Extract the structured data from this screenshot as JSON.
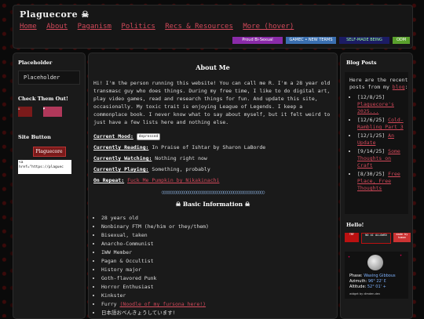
{
  "site": {
    "title": "Plaguecore"
  },
  "nav": [
    "Home",
    "About",
    "Paganism",
    "Politics",
    "Recs & Resources",
    "More (hover)"
  ],
  "header_buttons": [
    {
      "label": "Proud Bi-Sexual",
      "color": "#9c27b0"
    },
    {
      "label": "GAMEC • NEW TERMS",
      "color": "#3a6fb0"
    },
    {
      "label": "SELF-MADE BEING",
      "color": "#1c1c64"
    },
    {
      "label": "ODM",
      "color": "#5aa02c"
    }
  ],
  "left": {
    "placeholder_title": "Placeholder",
    "placeholder_text": "Placeholder",
    "check_title": "Check Them Out!",
    "site_button_title": "Site Button",
    "site_button_label": "Plaguecore",
    "code_snippet": "<a\nhref=\"https://plaguec"
  },
  "main": {
    "title": "About Me",
    "intro": "Hi! I'm the person running this website! You can call me R. I'm a 28 year old transmasc guy who does things. During my free time, I like to do digital art, play video games, read and research things for fun. And update this site, occasionally. My toxic trait is enjoying League of Legends. I keep a commonplace book. I never know what to say about myself, but it felt weird to just have a few lists here and nothing else.",
    "mood_label": "Current Mood:",
    "mood_value": "depressed",
    "reading_label": "Currently Reading:",
    "reading_value": "In Praise of Ishtar by Sharon LaBorde",
    "watching_label": "Currently Watching:",
    "watching_value": "Nothing right now",
    "playing_label": "Currently Playing:",
    "playing_value": "Something, probably",
    "repeat_label": "On Repeat:",
    "repeat_value": "Fuck Me Pumpkin by Nikakinachi",
    "basic_title": "Basic Information",
    "basic_info": [
      "28 years old",
      "Nonbinary FTM (he/him or they/them)",
      "Bisexual, taken",
      "Anarcho-Communist",
      "IWW Member",
      "Pagan & Occultist",
      "History major",
      "Goth-flavored Punk",
      "Horror Enthusiast",
      "Kinkster",
      "Furry",
      "日本語おべんきょうしています!"
    ],
    "furry_link": "(Noodle of my fursona here!)"
  },
  "right": {
    "blog_title": "Blog Posts",
    "recent_intro": "Here are the recent posts from my",
    "blog_link": "blog",
    "posts": [
      {
        "date": "[12/8/25]",
        "title": "Plaguecore's 2025..."
      },
      {
        "date": "[12/6/25]",
        "title": "Cold-Rambling Part 3"
      },
      {
        "date": "[12/1/25]",
        "title": "An Update"
      },
      {
        "date": "[9/14/25]",
        "title": "Some Thoughts on Craft"
      },
      {
        "date": "[8/30/25]",
        "title": "Free Place, Free Thoughts"
      }
    ],
    "hello_title": "Hello!",
    "hello_buttons": [
      "TMF",
      "NO AI ALLOWED",
      "made by human"
    ],
    "moon": {
      "phase_label": "Phase:",
      "phase_value": "Waxing Gibbous",
      "azimuth_label": "Azimuth:",
      "azimuth_value": "96° 22' Ɛ",
      "altitude_label": "Altitude:",
      "altitude_value": "52° 01' +",
      "credit": "widget by dimden.dev"
    }
  }
}
